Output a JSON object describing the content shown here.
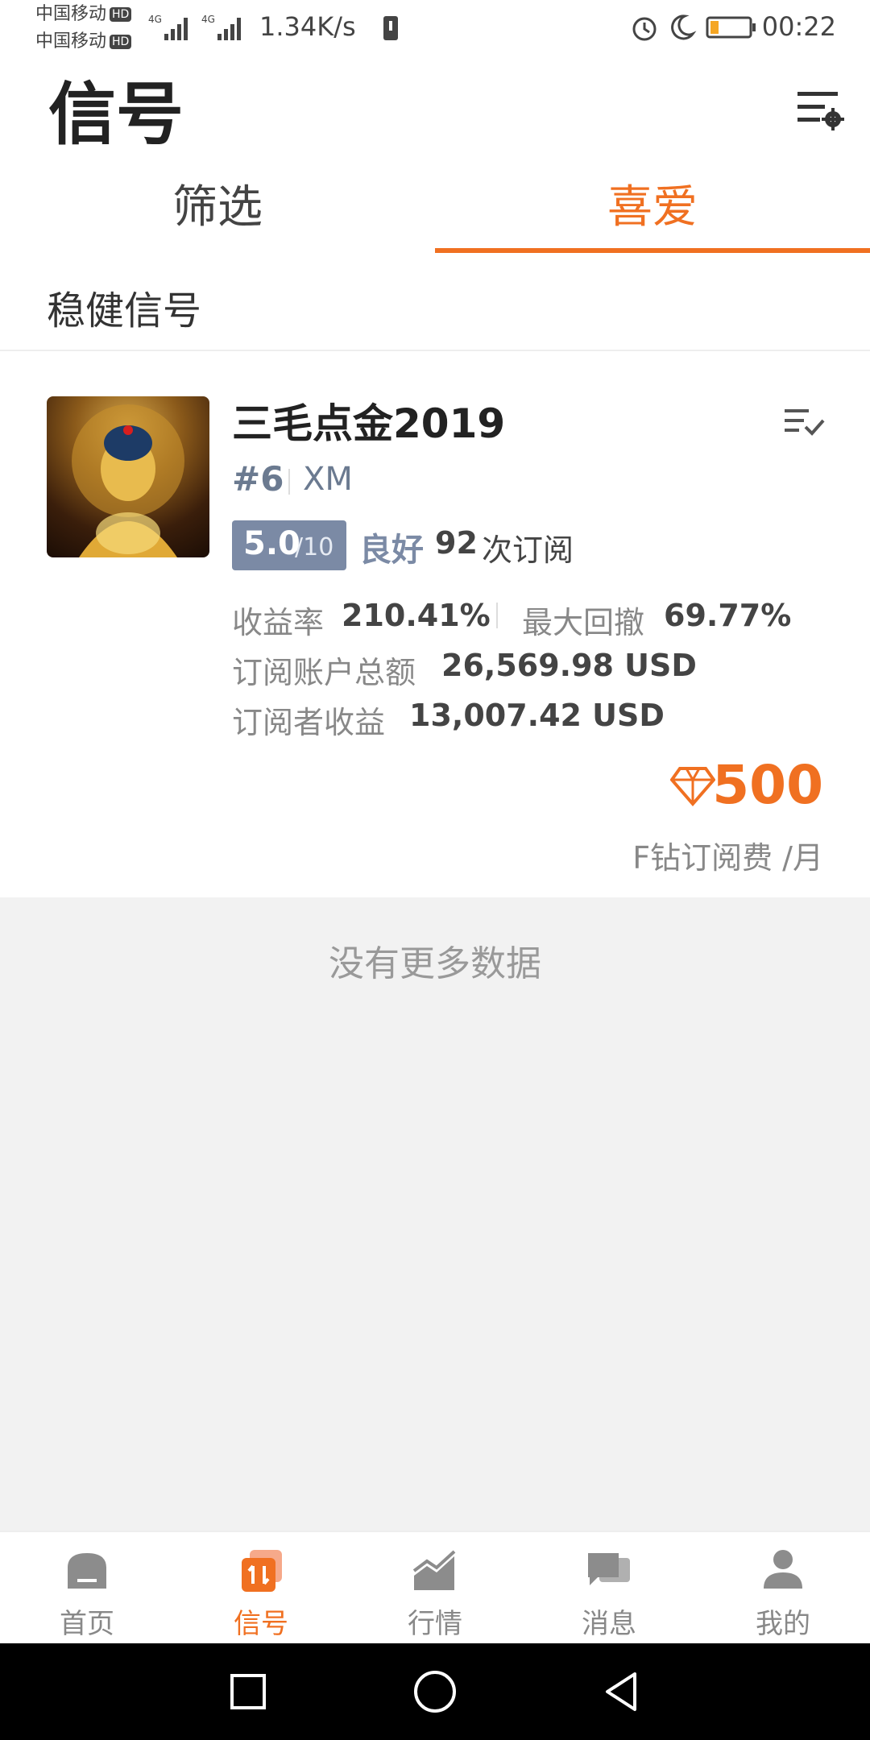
{
  "status_bar": {
    "carrier1": "中国移动",
    "carrier2": "中国移动",
    "hd": "HD",
    "net": "4G",
    "speed": "1.34K/s",
    "time": "00:22"
  },
  "header": {
    "title": "信号",
    "tabs": [
      {
        "label": "筛选",
        "active": false
      },
      {
        "label": "喜爱",
        "active": true
      }
    ],
    "accent_color": "#f07021"
  },
  "section": {
    "title": "稳健信号"
  },
  "signal_card": {
    "name": "三毛点金2019",
    "rank": "#6",
    "broker": "XM",
    "score": "5.0",
    "score_max": "/10",
    "rating": "良好",
    "subs_count": "92",
    "subs_label": "次订阅",
    "return_label": "收益率",
    "return_value": "210.41%",
    "drawdown_label": "最大回撤",
    "drawdown_value": "69.77%",
    "sub_total_label": "订阅账户总额",
    "sub_total_value": "26,569.98 USD",
    "sub_profit_label": "订阅者收益",
    "sub_profit_value": "13,007.42 USD",
    "price": "500",
    "price_label": "F钻订阅费 /月"
  },
  "no_more": "没有更多数据",
  "bottom_nav": [
    {
      "label": "首页",
      "icon": "home-icon",
      "active": false
    },
    {
      "label": "信号",
      "icon": "signal-icon",
      "active": true
    },
    {
      "label": "行情",
      "icon": "chart-icon",
      "active": false
    },
    {
      "label": "消息",
      "icon": "message-icon",
      "active": false
    },
    {
      "label": "我的",
      "icon": "profile-icon",
      "active": false
    }
  ]
}
